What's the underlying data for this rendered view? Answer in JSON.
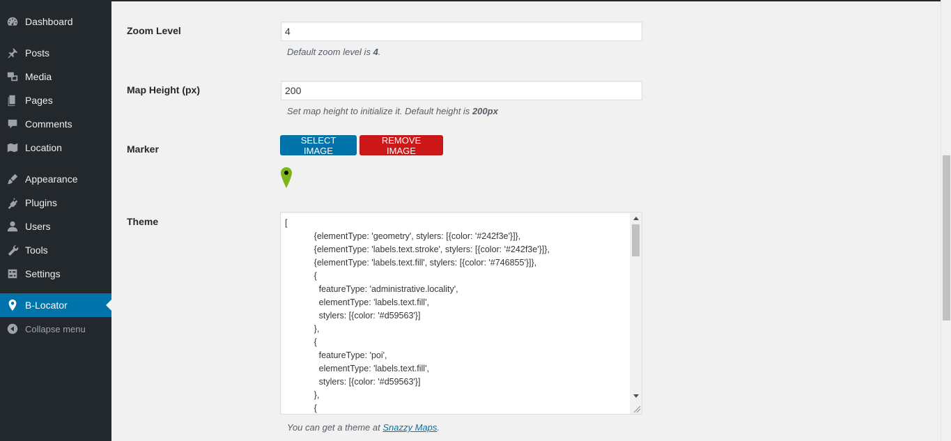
{
  "sidebar": {
    "items": [
      {
        "label": "Dashboard",
        "icon": "dashboard-icon"
      },
      {
        "label": "Posts",
        "icon": "pin-icon"
      },
      {
        "label": "Media",
        "icon": "media-icon"
      },
      {
        "label": "Pages",
        "icon": "pages-icon"
      },
      {
        "label": "Comments",
        "icon": "comment-icon"
      },
      {
        "label": "Location",
        "icon": "map-icon"
      },
      {
        "label": "Appearance",
        "icon": "brush-icon"
      },
      {
        "label": "Plugins",
        "icon": "plugin-icon"
      },
      {
        "label": "Users",
        "icon": "user-icon"
      },
      {
        "label": "Tools",
        "icon": "wrench-icon"
      },
      {
        "label": "Settings",
        "icon": "settings-icon"
      },
      {
        "label": "B-Locator",
        "icon": "location-pin-icon",
        "active": true
      }
    ],
    "collapse_label": "Collapse menu"
  },
  "form": {
    "zoom": {
      "label": "Zoom Level",
      "value": "4",
      "desc_prefix": "Default zoom level is ",
      "desc_bold": "4",
      "desc_suffix": "."
    },
    "height": {
      "label": "Map Height (px)",
      "value": "200",
      "desc_prefix": "Set map height to initialize it. Default height is ",
      "desc_bold": "200px"
    },
    "marker": {
      "label": "Marker",
      "select_label": "SELECT IMAGE",
      "remove_label": "REMOVE IMAGE",
      "marker_color": "#7cb518"
    },
    "theme": {
      "label": "Theme",
      "value": "[\n            {elementType: 'geometry', stylers: [{color: '#242f3e'}]},\n            {elementType: 'labels.text.stroke', stylers: [{color: '#242f3e'}]},\n            {elementType: 'labels.text.fill', stylers: [{color: '#746855'}]},\n            {\n              featureType: 'administrative.locality',\n              elementType: 'labels.text.fill',\n              stylers: [{color: '#d59563'}]\n            },\n            {\n              featureType: 'poi',\n              elementType: 'labels.text.fill',\n              stylers: [{color: '#d59563'}]\n            },\n            {",
      "desc_prefix": "You can get a theme at ",
      "desc_link": "Snazzy Maps",
      "desc_suffix": "."
    }
  }
}
